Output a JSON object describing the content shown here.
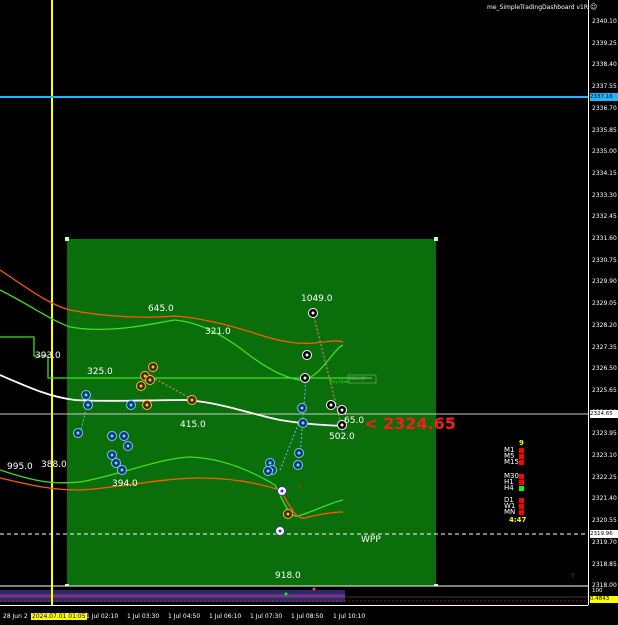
{
  "title": "me_SimpleTradingDashboard v1R",
  "price_axis": [
    "2340.10",
    "2339.25",
    "2338.40",
    "2337.55",
    "2336.70",
    "2335.85",
    "2335.00",
    "2334.15",
    "2333.30",
    "2332.45",
    "2331.60",
    "2330.75",
    "2329.90",
    "2329.05",
    "2328.20",
    "2327.35",
    "2326.50",
    "2325.65",
    "2324.80",
    "2323.95",
    "2323.10",
    "2322.25",
    "2321.40",
    "2320.55",
    "2319.70",
    "2318.85",
    "2318.00"
  ],
  "price_tags": {
    "cyan_level": "2337.16",
    "current": "2324.65",
    "wpp": "2319.96"
  },
  "indicator_panel": {
    "top": "100",
    "bottom": "0.4843"
  },
  "time_axis": [
    "28 Jun 2",
    "2024.07.01 01:05",
    "1 Jul 02:10",
    "1 Jul 03:30",
    "1 Jul 04:50",
    "1 Jul 06:10",
    "1 Jul 07:30",
    "1 Jul 08:50",
    "1 Jul 10:10"
  ],
  "labels": {
    "l645": "645.0",
    "l1049": "1049.0",
    "l321": "321.0",
    "l393": "393.0",
    "l325": "325.0",
    "l415": "415.0",
    "l65": "65.0",
    "l502": "502.0",
    "l995": "995.0",
    "l388": "388.0",
    "l394": "394.0",
    "l918": "918.0",
    "wpp": "WPP",
    "big_price": "< 2324.65",
    "small_tag": "2326.05",
    "buy_label": "Buy Open"
  },
  "dashboard": {
    "header": "9",
    "timeframes": [
      {
        "name": "M1",
        "color": "#ff0000"
      },
      {
        "name": "M5",
        "color": "#ff0000"
      },
      {
        "name": "M15",
        "color": "#ff0000"
      },
      {
        "name": "M30",
        "color": "#ff0000"
      },
      {
        "name": "H1",
        "color": "#ff0000"
      },
      {
        "name": "H4",
        "color": "#00ff00"
      },
      {
        "name": "D1",
        "color": "#ff0000"
      },
      {
        "name": "W1",
        "color": "#ff0000"
      },
      {
        "name": "MN",
        "color": "#ff0000"
      }
    ],
    "countdown": "4:47"
  },
  "colors": {
    "box": "#0a6e0a",
    "cyan": "#1fb6ff",
    "yellow": "#ffff00",
    "red_text": "#ff1a1a",
    "orange_line": "#ff5a00",
    "green_line": "#44dd22",
    "white_line": "#ffffff"
  }
}
